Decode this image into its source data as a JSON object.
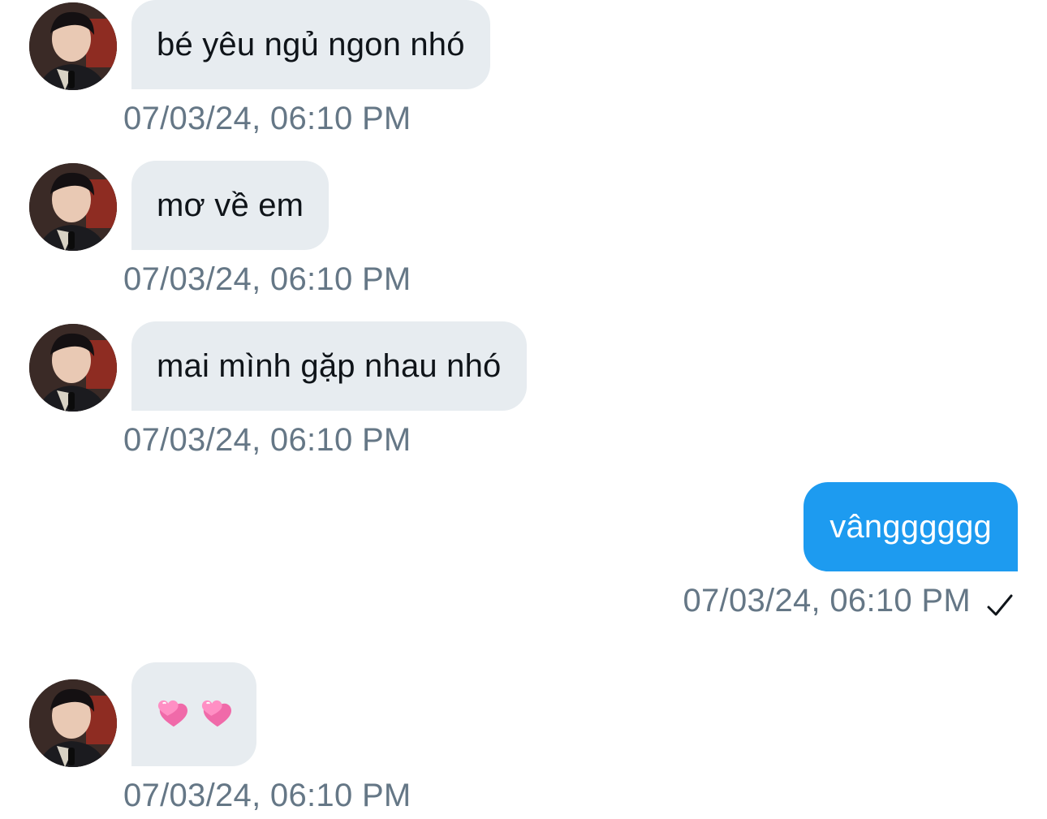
{
  "messages": [
    {
      "direction": "incoming",
      "text": "bé yêu ngủ ngon nhó",
      "timestamp": "07/03/24, 06:10 PM"
    },
    {
      "direction": "incoming",
      "text": "mơ về em",
      "timestamp": "07/03/24, 06:10 PM"
    },
    {
      "direction": "incoming",
      "text": "mai mình gặp nhau nhó",
      "timestamp": "07/03/24, 06:10 PM"
    },
    {
      "direction": "outgoing",
      "text": "vângggggg",
      "timestamp": "07/03/24, 06:10 PM",
      "status_icon": "checkmark-icon"
    },
    {
      "direction": "incoming",
      "text": "💞 💞",
      "timestamp": "07/03/24, 06:10 PM",
      "content_icons": [
        "two-hearts-icon",
        "two-hearts-icon"
      ]
    }
  ],
  "colors": {
    "incoming_bubble": "#e7ecf0",
    "outgoing_bubble": "#1d9bf0",
    "timestamp_text": "#657786",
    "incoming_text": "#0f1419",
    "outgoing_text": "#ffffff"
  }
}
